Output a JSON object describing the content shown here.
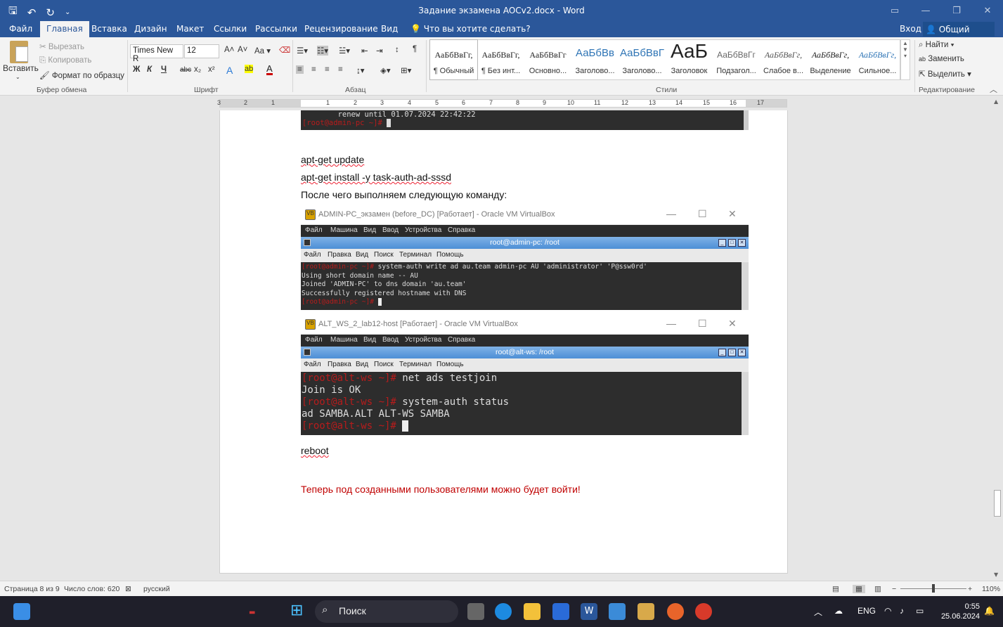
{
  "window": {
    "title": "Задание экзамена AOCv2.docx - Word",
    "qat_icons": [
      "save-icon",
      "undo-icon",
      "redo-icon",
      "customize-icon"
    ]
  },
  "tabs": [
    "Файл",
    "Главная",
    "Вставка",
    "Дизайн",
    "Макет",
    "Ссылки",
    "Рассылки",
    "Рецензирование",
    "Вид"
  ],
  "active_tab": "Главная",
  "tell_me": "Что вы хотите сделать?",
  "sign_in": "Вход",
  "share": "Общий доступ",
  "clipboard": {
    "paste": "Вставить",
    "cut": "Вырезать",
    "copy": "Копировать",
    "format_painter": "Формат по образцу",
    "label": "Буфер обмена"
  },
  "font": {
    "name": "Times New R",
    "size": "12",
    "label": "Шрифт",
    "bold": "Ж",
    "italic": "К",
    "underline": "Ч",
    "strike": "abc"
  },
  "paragraph": {
    "label": "Абзац"
  },
  "styles": {
    "label": "Стили",
    "items": [
      {
        "sample": "АаБбВвГг,",
        "name": "¶ Обычный"
      },
      {
        "sample": "АаБбВвГг,",
        "name": "¶ Без инт..."
      },
      {
        "sample": "АаБбВвГг",
        "name": "Основно..."
      },
      {
        "sample": "АаБбВв",
        "name": "Заголово..."
      },
      {
        "sample": "АаБбВвГ",
        "name": "Заголово..."
      },
      {
        "sample": "АаБ",
        "name": "Заголовок"
      },
      {
        "sample": "АаБбВвГг",
        "name": "Подзагол..."
      },
      {
        "sample": "АаБбВвГг,",
        "name": "Слабое в..."
      },
      {
        "sample": "АаБбВвГг,",
        "name": "Выделение"
      },
      {
        "sample": "АаБбВвГг,",
        "name": "Сильное..."
      }
    ]
  },
  "editing": {
    "find": "Найти",
    "replace": "Заменить",
    "select": "Выделить",
    "label": "Редактирование"
  },
  "ruler": [
    "3",
    "2",
    "1",
    "1",
    "2",
    "3",
    "4",
    "5",
    "6",
    "7",
    "8",
    "9",
    "10",
    "11",
    "12",
    "13",
    "14",
    "15",
    "16",
    "17"
  ],
  "document": {
    "top_term": {
      "line1": "        renew until 01.07.2024 22:42:22",
      "prompt": "[root@admin-pc ~]#"
    },
    "p1": "apt-get update",
    "p2": "apt-get install -y task-auth-ad-sssd",
    "p3": "После чего выполняем следующую команду:",
    "vb1": {
      "title": "ADMIN-PC_экзамен (before_DC) [Работает] - Oracle VM VirtualBox",
      "menu": [
        "Файл",
        "Машина",
        "Вид",
        "Ввод",
        "Устройства",
        "Справка"
      ],
      "term_title": "root@admin-pc: /root",
      "term_menu": [
        "Файл",
        "Правка",
        "Вид",
        "Поиск",
        "Терминал",
        "Помощь"
      ],
      "prompt": "[root@admin-pc ~]#",
      "cmd": " system-auth write ad au.team admin-pc AU 'administrator' 'P@ssw0rd'",
      "out1": "Using short domain name -- AU",
      "out2": "Joined 'ADMIN-PC' to dns domain 'au.team'",
      "out3": "Successfully registered hostname with DNS"
    },
    "vb2": {
      "title": "ALT_WS_2_lab12-host [Работает] - Oracle VM VirtualBox",
      "menu": [
        "Файл",
        "Машина",
        "Вид",
        "Ввод",
        "Устройства",
        "Справка"
      ],
      "term_title": "root@alt-ws: /root",
      "term_menu": [
        "Файл",
        "Правка",
        "Вид",
        "Поиск",
        "Терминал",
        "Помощь"
      ],
      "prompt": "[root@alt-ws ~]#",
      "cmd1": " net ads testjoin",
      "out1": "Join is OK",
      "cmd2": " system-auth status",
      "out2": "ad SAMBA.ALT ALT-WS SAMBA"
    },
    "p4": "reboot",
    "p5": "Теперь под созданными пользователями можно будет войти!"
  },
  "status": {
    "page": "Страница 8 из 9",
    "words": "Число слов: 620",
    "lang": "русский",
    "zoom": "110%"
  },
  "taskbar": {
    "search": "Поиск",
    "lang": "ENG",
    "time": "0:55",
    "date": "25.06.2024"
  },
  "colors": {
    "accent": "#2b579a",
    "red_text": "#c00000",
    "prompt": "#b71c1c"
  }
}
